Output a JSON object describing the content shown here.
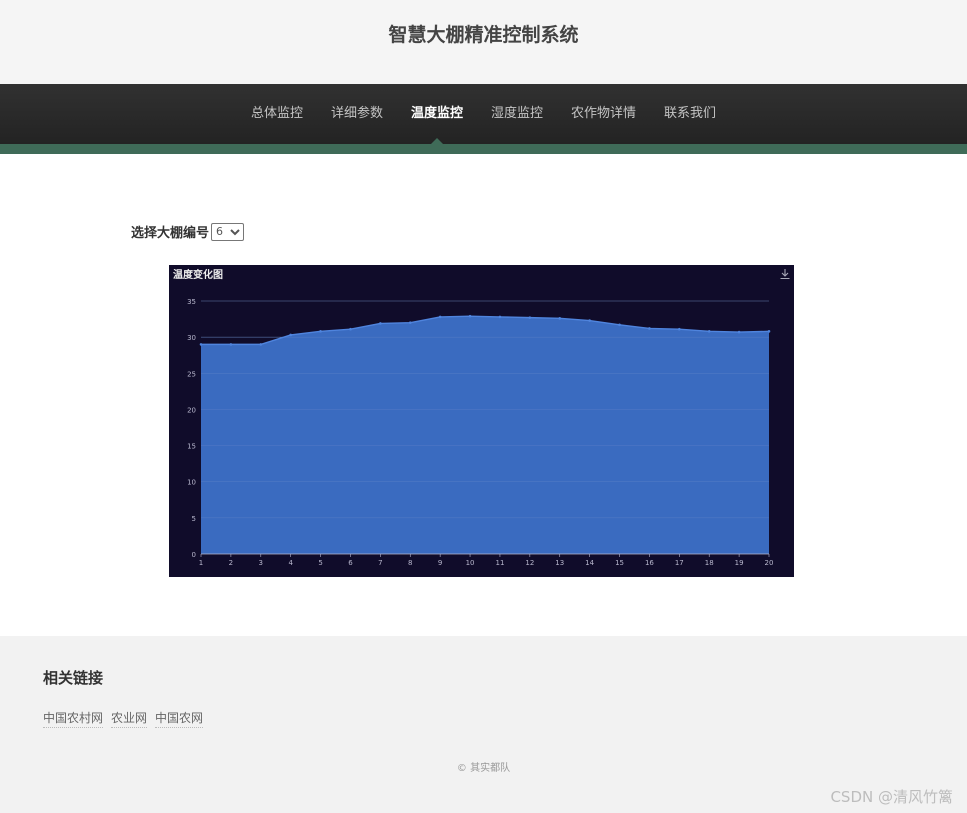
{
  "header": {
    "title": "智慧大棚精准控制系统"
  },
  "nav": {
    "items": [
      {
        "label": "总体监控"
      },
      {
        "label": "详细参数"
      },
      {
        "label": "温度监控",
        "active": true
      },
      {
        "label": "湿度监控"
      },
      {
        "label": "农作物详情"
      },
      {
        "label": "联系我们"
      }
    ]
  },
  "selector": {
    "label": "选择大棚编号",
    "selected": "6"
  },
  "chart": {
    "title": "温度变化图",
    "colors": {
      "background": "#100c2a",
      "area": "#3a6bc0",
      "line": "#4f84dd",
      "axis_text": "#b9b8ce",
      "grid": "#484753"
    }
  },
  "chart_data": {
    "type": "area",
    "title": "温度变化图",
    "x": [
      1,
      2,
      3,
      4,
      5,
      6,
      7,
      8,
      9,
      10,
      11,
      12,
      13,
      14,
      15,
      16,
      17,
      18,
      19,
      20
    ],
    "series": [
      {
        "values": [
          29,
          29,
          29,
          30.3,
          30.8,
          31.1,
          31.9,
          32,
          32.8,
          32.9,
          32.8,
          32.7,
          32.6,
          32.3,
          31.7,
          31.2,
          31.1,
          30.8,
          30.7,
          30.8
        ]
      }
    ],
    "ylim": [
      0,
      35
    ],
    "yticks": [
      0,
      5,
      10,
      15,
      20,
      25,
      30,
      35
    ],
    "grid": true,
    "legend": "none"
  },
  "footer": {
    "heading": "相关链接",
    "links": [
      {
        "label": "中国农村网"
      },
      {
        "label": "农业网"
      },
      {
        "label": "中国农网"
      }
    ],
    "copyright": "© 其实都队"
  },
  "watermark": "CSDN @清风竹篱"
}
